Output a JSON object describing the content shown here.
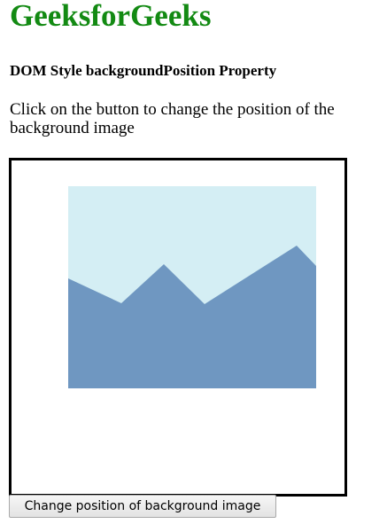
{
  "header": {
    "title": "GeeksforGeeks",
    "subtitle": "DOM Style backgroundPosition Property"
  },
  "main": {
    "instructions": "Click on the button to change the position of the background image",
    "background_image": {
      "icon": "landscape-image-icon",
      "sky_color": "#d4eef4",
      "mountain_color": "#6f97c1"
    },
    "button_label": "Change position of background image"
  },
  "colors": {
    "title_green": "#138a13",
    "box_border": "#000000"
  }
}
